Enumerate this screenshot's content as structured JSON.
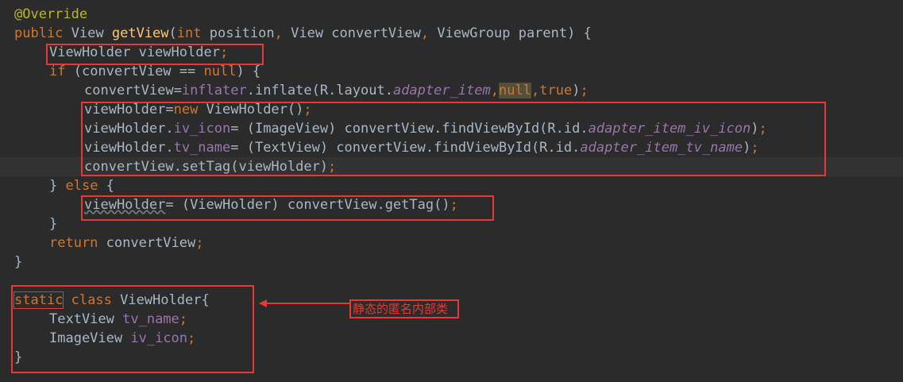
{
  "code": {
    "annotation": "@Override",
    "kw_public": "public",
    "type_view": "View",
    "method_getview": "getView",
    "sig_open": "(",
    "kw_int": "int",
    "sig_rest1": " position",
    "comma": ",",
    "sig_rest2": " View convertView",
    "sig_rest3": " ViewGroup parent) {",
    "decl_text": "ViewHolder viewHolder",
    "kw_if": "if",
    "if_cond_a": " (convertView == ",
    "kw_null": "null",
    "if_cond_b": ") {",
    "inflate_a": "convertView=",
    "field_inflater": "inflater",
    "inflate_b": ".inflate(R.layout.",
    "field_adapter_item": "adapter_item",
    "kw_true": "true",
    "inflate_end": ")",
    "vh_new_a": "viewHolder=",
    "kw_new": "new",
    "vh_new_b": " ViewHolder()",
    "vh_dot": "viewHolder.",
    "field_iv_icon": "iv_icon",
    "iv_cast": "= (ImageView) convertView.findViewById(R.id.",
    "field_id_iv_icon": "adapter_item_iv_icon",
    "field_tv_name": "tv_name",
    "tv_cast": "= (TextView) convertView.findViewById(R.id.",
    "field_id_tv_name": "adapter_item_tv_name",
    "close_paren": ")",
    "settag": "convertView.setTag(viewHolder)",
    "else_close": "} ",
    "kw_else": "else",
    "brace_open": " {",
    "var_viewholder": "viewHolder",
    "gettag": "= (ViewHolder) convertView.getTag()",
    "brace_close": "}",
    "kw_return": "return",
    "return_val": " convertView",
    "kw_static": "static",
    "kw_class": "class",
    "class_decl": " ViewHolder{",
    "type_textview": "TextView ",
    "type_imageview": "ImageView ",
    "semicolon": ";",
    "space": " "
  },
  "annotation_note": "静态的匿名内部类",
  "colors": {
    "background": "#2b2b2b",
    "default_text": "#a9b7c6",
    "keyword": "#cc7832",
    "annotation": "#bbb529",
    "method": "#ffc66d",
    "field": "#9876aa",
    "highlight_box": "#e53935"
  }
}
